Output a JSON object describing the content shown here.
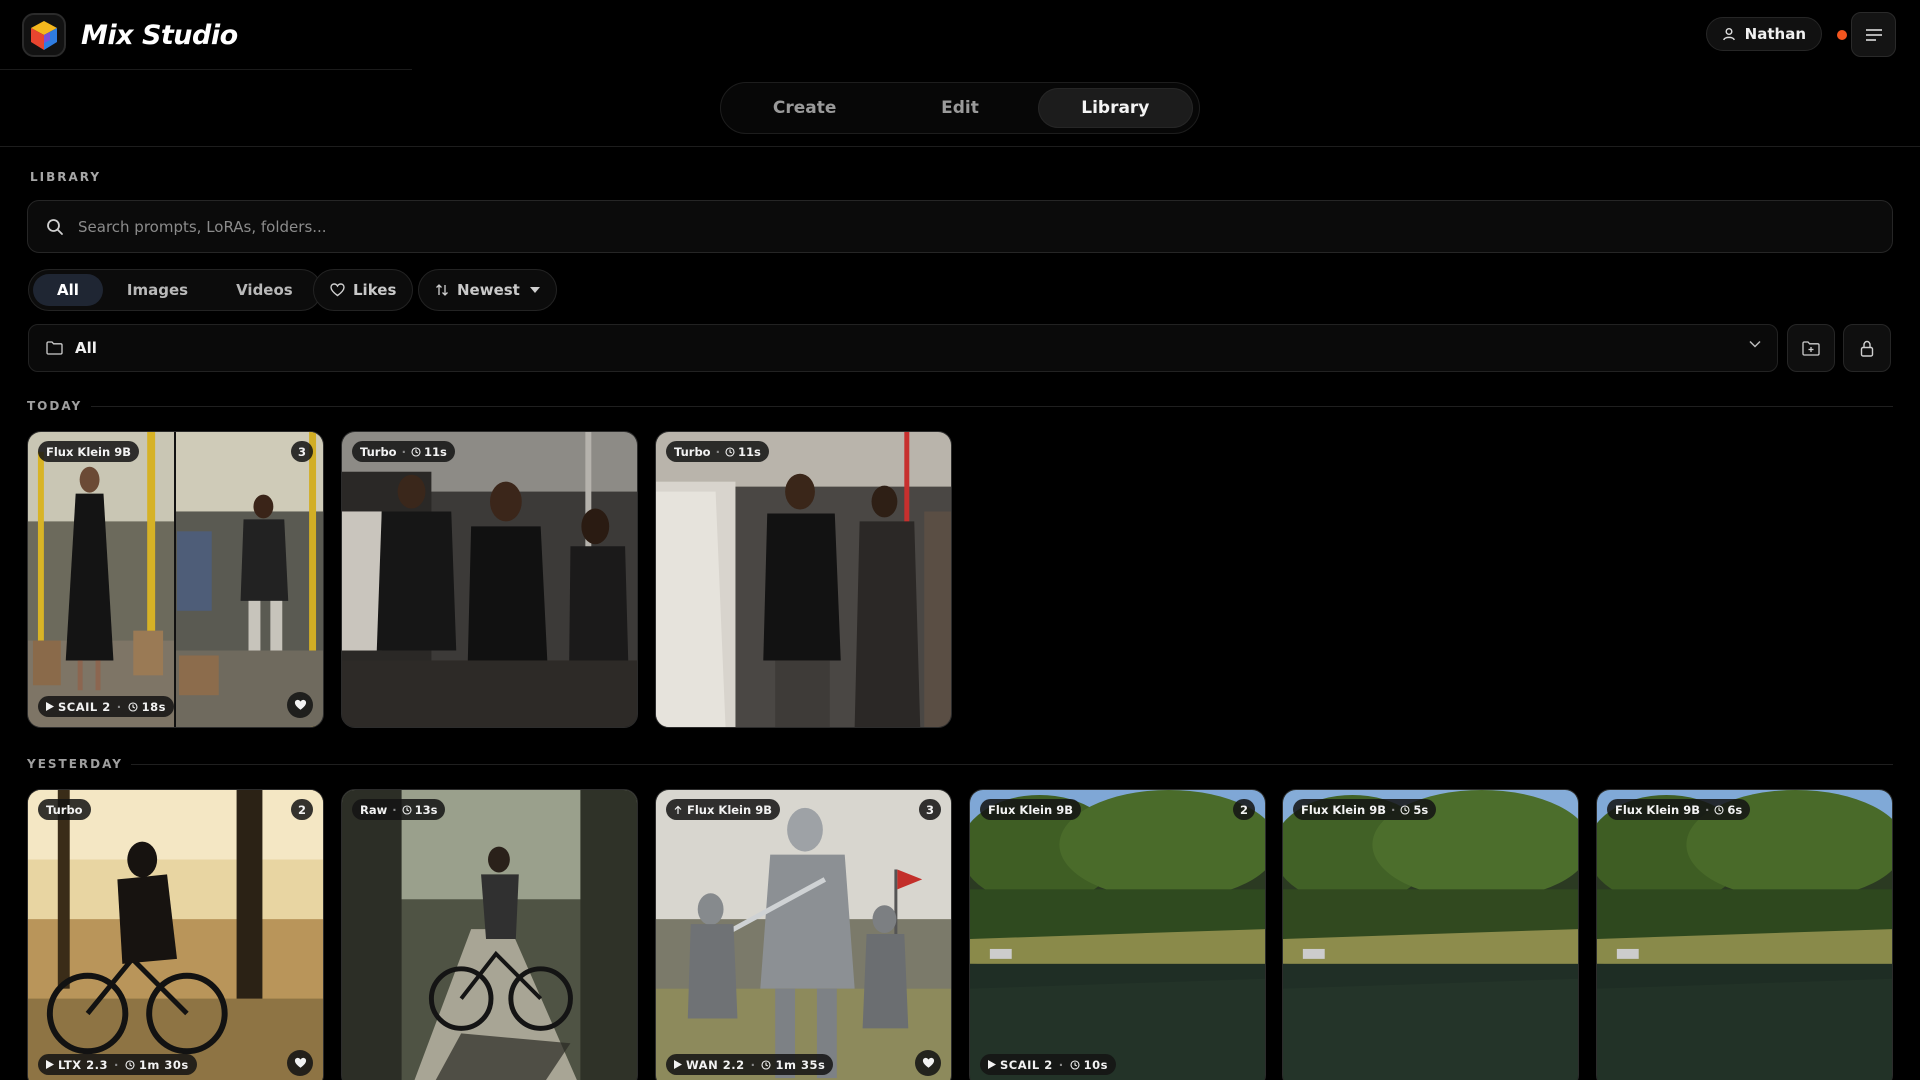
{
  "app": {
    "title": "Mix Studio"
  },
  "header": {
    "user_name": "Nathan",
    "status_color": "#f2551e"
  },
  "tabs": [
    {
      "label": "Create",
      "active": false
    },
    {
      "label": "Edit",
      "active": false
    },
    {
      "label": "Library",
      "active": true
    }
  ],
  "library": {
    "section_title": "LIBRARY",
    "search_placeholder": "Search prompts, LoRAs, folders...",
    "filters": {
      "all": "All",
      "images": "Images",
      "videos": "Videos",
      "active": "All"
    },
    "likes_label": "Likes",
    "sort_label": "Newest",
    "folder_label": "All"
  },
  "groups": {
    "today": {
      "label": "TODAY",
      "cards": [
        {
          "model": "Flux Klein 9B",
          "count": "3",
          "video_model": "SCAIL 2",
          "duration": "18s",
          "liked": true
        },
        {
          "model": "Turbo",
          "time": "11s"
        },
        {
          "model": "Turbo",
          "time": "11s"
        }
      ]
    },
    "yesterday": {
      "label": "YESTERDAY",
      "cards": [
        {
          "model": "Turbo",
          "count": "2",
          "video_model": "LTX 2.3",
          "duration": "1m 30s",
          "liked": true
        },
        {
          "model": "Raw",
          "time": "13s"
        },
        {
          "model": "Flux Klein 9B",
          "count": "3",
          "video_model": "WAN 2.2",
          "duration": "1m 35s",
          "liked": true,
          "upscaled": true
        },
        {
          "model": "Flux Klein 9B",
          "count": "2",
          "video_model": "SCAIL 2",
          "duration": "10s"
        },
        {
          "model": "Flux Klein 9B",
          "time": "5s"
        },
        {
          "model": "Flux Klein 9B",
          "time": "6s"
        }
      ]
    }
  }
}
